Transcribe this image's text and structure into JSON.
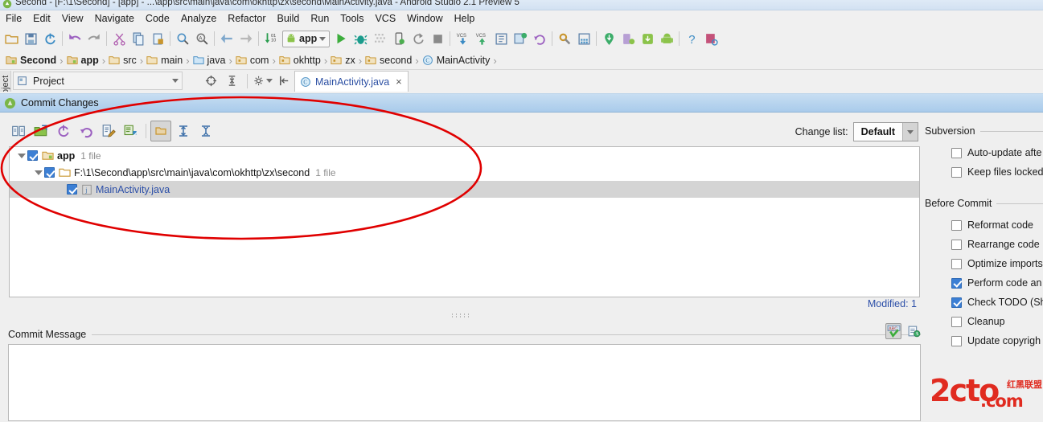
{
  "titlebar": {
    "text": "Second - [F:\\1\\Second] - [app] - ...\\app\\src\\main\\java\\com\\okhttp\\zx\\second\\MainActivity.java - Android Studio 2.1 Preview 5",
    "icon": "android-studio-icon"
  },
  "menubar": {
    "items": [
      {
        "label": "File"
      },
      {
        "label": "Edit"
      },
      {
        "label": "View"
      },
      {
        "label": "Navigate"
      },
      {
        "label": "Code"
      },
      {
        "label": "Analyze"
      },
      {
        "label": "Refactor"
      },
      {
        "label": "Build"
      },
      {
        "label": "Run"
      },
      {
        "label": "Tools"
      },
      {
        "label": "VCS"
      },
      {
        "label": "Window"
      },
      {
        "label": "Help"
      }
    ]
  },
  "toolbar": {
    "run_config_label": "app",
    "icons": [
      "open-folder-icon",
      "save-all-icon",
      "sync-icon",
      "undo-icon",
      "redo-icon",
      "cut-icon",
      "copy-icon",
      "paste-icon",
      "find-icon",
      "replace-icon",
      "back-icon",
      "forward-icon",
      "sort-numeric-icon",
      "run-icon",
      "debug-icon",
      "coverage-icon",
      "attach-debugger-icon",
      "rerun-icon",
      "stop-icon",
      "vcs-update-icon",
      "vcs-commit-icon",
      "vcs-history-icon",
      "vcs-changes-icon",
      "vcs-rollback-icon",
      "settings-icon",
      "project-structure-icon",
      "sdk-download-icon",
      "avd-manager-icon",
      "sdk-manager-icon",
      "android-device-icon",
      "help-icon",
      "layout-inspector-icon"
    ]
  },
  "breadcrumb": {
    "items": [
      {
        "label": "Second",
        "icon": "module-icon",
        "bold": true
      },
      {
        "label": "app",
        "icon": "module-icon",
        "bold": true
      },
      {
        "label": "src",
        "icon": "folder-icon",
        "bold": false
      },
      {
        "label": "main",
        "icon": "folder-icon",
        "bold": false
      },
      {
        "label": "java",
        "icon": "source-folder-icon",
        "bold": false
      },
      {
        "label": "com",
        "icon": "package-icon",
        "bold": false
      },
      {
        "label": "okhttp",
        "icon": "package-icon",
        "bold": false
      },
      {
        "label": "zx",
        "icon": "package-icon",
        "bold": false
      },
      {
        "label": "second",
        "icon": "package-icon",
        "bold": false
      },
      {
        "label": "MainActivity",
        "icon": "class-icon",
        "bold": false
      }
    ]
  },
  "toolwindow": {
    "vertical_tab": "Project",
    "project_combo": "Project",
    "editor_tab": {
      "label": "MainActivity.java",
      "icon": "class-icon",
      "close": "×"
    }
  },
  "commit_dialog": {
    "header_title": "Commit Changes",
    "toolbar_icons": [
      "show-diff-icon",
      "move-to-changelist-icon",
      "refresh-icon",
      "rollback-icon",
      "edit-source-icon",
      "show-as-tree-icon",
      "group-by-directory-icon",
      "expand-all-icon",
      "collapse-all-icon"
    ],
    "changelist": {
      "label": "Change list:",
      "value": "Default"
    },
    "tree": [
      {
        "level": 0,
        "expanded": true,
        "checked": true,
        "icon": "module-icon",
        "label": "app",
        "bold": true,
        "link": false,
        "count": "1 file",
        "selected": false
      },
      {
        "level": 1,
        "expanded": true,
        "checked": true,
        "icon": "folder-icon",
        "label": "F:\\1\\Second\\app\\src\\main\\java\\com\\okhttp\\zx\\second",
        "bold": false,
        "link": false,
        "count": "1 file",
        "selected": false
      },
      {
        "level": 2,
        "expanded": null,
        "checked": true,
        "icon": "java-file-icon",
        "label": "MainActivity.java",
        "bold": false,
        "link": true,
        "count": "",
        "selected": true
      }
    ],
    "modified_text": "Modified: 1",
    "commit_message": {
      "label": "Commit Message",
      "value": "",
      "placeholder": "",
      "icons": [
        "spellcheck-icon",
        "message-history-icon"
      ]
    }
  },
  "options_panel": {
    "groups": [
      {
        "title": "Subversion",
        "items": [
          {
            "label": "Auto-update afte",
            "checked": false
          },
          {
            "label": "Keep files locked",
            "checked": false
          }
        ]
      },
      {
        "title": "Before Commit",
        "items": [
          {
            "label": "Reformat code",
            "checked": false
          },
          {
            "label": "Rearrange code",
            "checked": false
          },
          {
            "label": "Optimize imports",
            "checked": false
          },
          {
            "label": "Perform code an",
            "checked": true
          },
          {
            "label": "Check TODO (Sh",
            "checked": true
          },
          {
            "label": "Cleanup",
            "checked": false
          },
          {
            "label": "Update copyrigh",
            "checked": false
          }
        ]
      }
    ]
  },
  "watermark": {
    "main": "2cto",
    "domain": ".com",
    "cn": "红黑联盟"
  },
  "colors": {
    "accent_blue": "#3c7fd4",
    "link_blue": "#2c4fa8",
    "annotation_red": "#e00000",
    "header_blue": "#a9cbeb",
    "watermark_red": "#e02b20"
  }
}
